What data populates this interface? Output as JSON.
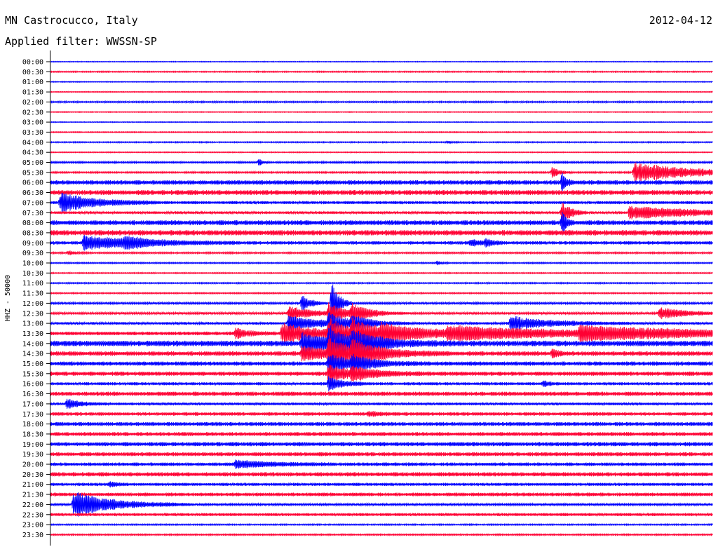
{
  "header": {
    "station": "MN Castrocucco, Italy",
    "date": "2012-04-12",
    "filter_label": "Applied filter:",
    "filter_name": "WWSSN-SP"
  },
  "chart_data": {
    "type": "line",
    "subtype": "helicorder",
    "title": "MN Castrocucco, Italy",
    "ylabel": "HHZ - 50000",
    "colors": {
      "even": "#0000ff",
      "odd": "#ff0033",
      "axis": "#000000"
    },
    "grid": false,
    "rows": [
      {
        "label": "00:00",
        "noise": 0.6,
        "events": []
      },
      {
        "label": "00:30",
        "noise": 0.9,
        "events": []
      },
      {
        "label": "01:00",
        "noise": 0.6,
        "events": []
      },
      {
        "label": "01:30",
        "noise": 0.7,
        "events": []
      },
      {
        "label": "02:00",
        "noise": 1.1,
        "events": []
      },
      {
        "label": "02:30",
        "noise": 0.6,
        "events": []
      },
      {
        "label": "03:00",
        "noise": 0.6,
        "events": []
      },
      {
        "label": "03:30",
        "noise": 0.8,
        "events": []
      },
      {
        "label": "04:00",
        "noise": 0.9,
        "events": [
          {
            "t": 0.6,
            "amp": 2,
            "dur": 0.006
          }
        ]
      },
      {
        "label": "04:30",
        "noise": 0.7,
        "events": []
      },
      {
        "label": "05:00",
        "noise": 1.3,
        "events": [
          {
            "t": 0.315,
            "amp": 6,
            "dur": 0.004
          }
        ]
      },
      {
        "label": "05:30",
        "noise": 1.2,
        "events": [
          {
            "t": 0.758,
            "amp": 8,
            "dur": 0.01
          },
          {
            "t": 0.882,
            "amp": 14,
            "dur": 0.09
          }
        ]
      },
      {
        "label": "06:00",
        "noise": 3.2,
        "events": [
          {
            "t": 0.773,
            "amp": 14,
            "dur": 0.006
          }
        ]
      },
      {
        "label": "06:30",
        "noise": 3.5,
        "events": []
      },
      {
        "label": "07:00",
        "noise": 2.2,
        "events": [
          {
            "t": 0.015,
            "amp": 14,
            "dur": 0.05
          }
        ]
      },
      {
        "label": "07:30",
        "noise": 2.0,
        "events": [
          {
            "t": 0.773,
            "amp": 16,
            "dur": 0.012
          },
          {
            "t": 0.875,
            "amp": 9,
            "dur": 0.1
          }
        ]
      },
      {
        "label": "08:00",
        "noise": 3.5,
        "events": [
          {
            "t": 0.773,
            "amp": 16,
            "dur": 0.006
          }
        ]
      },
      {
        "label": "08:30",
        "noise": 3.8,
        "events": []
      },
      {
        "label": "09:00",
        "noise": 2.4,
        "events": [
          {
            "t": 0.05,
            "amp": 10,
            "dur": 0.08
          },
          {
            "t": 0.113,
            "amp": 6,
            "dur": 0.03
          },
          {
            "t": 0.635,
            "amp": 5,
            "dur": 0.012
          },
          {
            "t": 0.657,
            "amp": 5,
            "dur": 0.012
          }
        ]
      },
      {
        "label": "09:30",
        "noise": 1.2,
        "events": [
          {
            "t": 0.027,
            "amp": 3,
            "dur": 0.01
          }
        ]
      },
      {
        "label": "10:00",
        "noise": 1.0,
        "events": [
          {
            "t": 0.585,
            "amp": 3,
            "dur": 0.006
          }
        ]
      },
      {
        "label": "10:30",
        "noise": 0.9,
        "events": []
      },
      {
        "label": "11:00",
        "noise": 1.0,
        "events": []
      },
      {
        "label": "11:30",
        "noise": 1.0,
        "events": []
      },
      {
        "label": "12:00",
        "noise": 1.5,
        "events": [
          {
            "t": 0.38,
            "amp": 14,
            "dur": 0.012
          },
          {
            "t": 0.425,
            "amp": 35,
            "dur": 0.01
          }
        ]
      },
      {
        "label": "12:30",
        "noise": 1.6,
        "events": [
          {
            "t": 0.36,
            "amp": 10,
            "dur": 0.04
          },
          {
            "t": 0.42,
            "amp": 14,
            "dur": 0.025
          },
          {
            "t": 0.455,
            "amp": 11,
            "dur": 0.03
          },
          {
            "t": 0.92,
            "amp": 8,
            "dur": 0.04
          }
        ]
      },
      {
        "label": "13:00",
        "noise": 1.9,
        "events": [
          {
            "t": 0.36,
            "amp": 12,
            "dur": 0.04
          },
          {
            "t": 0.42,
            "amp": 14,
            "dur": 0.025
          },
          {
            "t": 0.455,
            "amp": 10,
            "dur": 0.03
          },
          {
            "t": 0.695,
            "amp": 10,
            "dur": 0.06
          }
        ]
      },
      {
        "label": "13:30",
        "noise": 2.6,
        "events": [
          {
            "t": 0.28,
            "amp": 7,
            "dur": 0.02
          },
          {
            "t": 0.35,
            "amp": 14,
            "dur": 0.06
          },
          {
            "t": 0.42,
            "amp": 20,
            "dur": 0.03
          },
          {
            "t": 0.455,
            "amp": 14,
            "dur": 0.05
          },
          {
            "t": 0.5,
            "amp": 8,
            "dur": 0.11
          },
          {
            "t": 0.6,
            "amp": 8,
            "dur": 0.2
          },
          {
            "t": 0.8,
            "amp": 8,
            "dur": 0.2
          }
        ]
      },
      {
        "label": "14:00",
        "noise": 4.0,
        "events": [
          {
            "t": 0.38,
            "amp": 14,
            "dur": 0.05
          },
          {
            "t": 0.42,
            "amp": 20,
            "dur": 0.03
          },
          {
            "t": 0.455,
            "amp": 12,
            "dur": 0.05
          }
        ]
      },
      {
        "label": "14:30",
        "noise": 3.2,
        "events": [
          {
            "t": 0.38,
            "amp": 10,
            "dur": 0.05
          },
          {
            "t": 0.42,
            "amp": 22,
            "dur": 0.03
          },
          {
            "t": 0.455,
            "amp": 14,
            "dur": 0.05
          },
          {
            "t": 0.758,
            "amp": 6,
            "dur": 0.008
          }
        ]
      },
      {
        "label": "15:00",
        "noise": 3.0,
        "events": [
          {
            "t": 0.42,
            "amp": 14,
            "dur": 0.03
          },
          {
            "t": 0.455,
            "amp": 8,
            "dur": 0.04
          }
        ]
      },
      {
        "label": "15:30",
        "noise": 3.0,
        "events": [
          {
            "t": 0.42,
            "amp": 12,
            "dur": 0.03
          },
          {
            "t": 0.455,
            "amp": 7,
            "dur": 0.04
          }
        ]
      },
      {
        "label": "16:00",
        "noise": 2.2,
        "events": [
          {
            "t": 0.42,
            "amp": 10,
            "dur": 0.02
          },
          {
            "t": 0.745,
            "amp": 4,
            "dur": 0.008
          }
        ]
      },
      {
        "label": "16:30",
        "noise": 3.0,
        "events": []
      },
      {
        "label": "17:00",
        "noise": 2.0,
        "events": [
          {
            "t": 0.025,
            "amp": 6,
            "dur": 0.02
          }
        ]
      },
      {
        "label": "17:30",
        "noise": 2.5,
        "events": [
          {
            "t": 0.48,
            "amp": 3,
            "dur": 0.02
          }
        ]
      },
      {
        "label": "18:00",
        "noise": 2.8,
        "events": []
      },
      {
        "label": "18:30",
        "noise": 2.8,
        "events": []
      },
      {
        "label": "19:00",
        "noise": 3.0,
        "events": []
      },
      {
        "label": "19:30",
        "noise": 2.8,
        "events": []
      },
      {
        "label": "20:00",
        "noise": 2.5,
        "events": [
          {
            "t": 0.28,
            "amp": 5,
            "dur": 0.05
          }
        ]
      },
      {
        "label": "20:30",
        "noise": 3.0,
        "events": []
      },
      {
        "label": "21:00",
        "noise": 2.2,
        "events": [
          {
            "t": 0.09,
            "amp": 3,
            "dur": 0.01
          }
        ]
      },
      {
        "label": "21:30",
        "noise": 2.6,
        "events": []
      },
      {
        "label": "22:00",
        "noise": 1.6,
        "events": [
          {
            "t": 0.035,
            "amp": 18,
            "dur": 0.06
          }
        ]
      },
      {
        "label": "22:30",
        "noise": 2.2,
        "events": []
      },
      {
        "label": "23:00",
        "noise": 1.0,
        "events": []
      },
      {
        "label": "23:30",
        "noise": 1.1,
        "events": []
      }
    ]
  }
}
